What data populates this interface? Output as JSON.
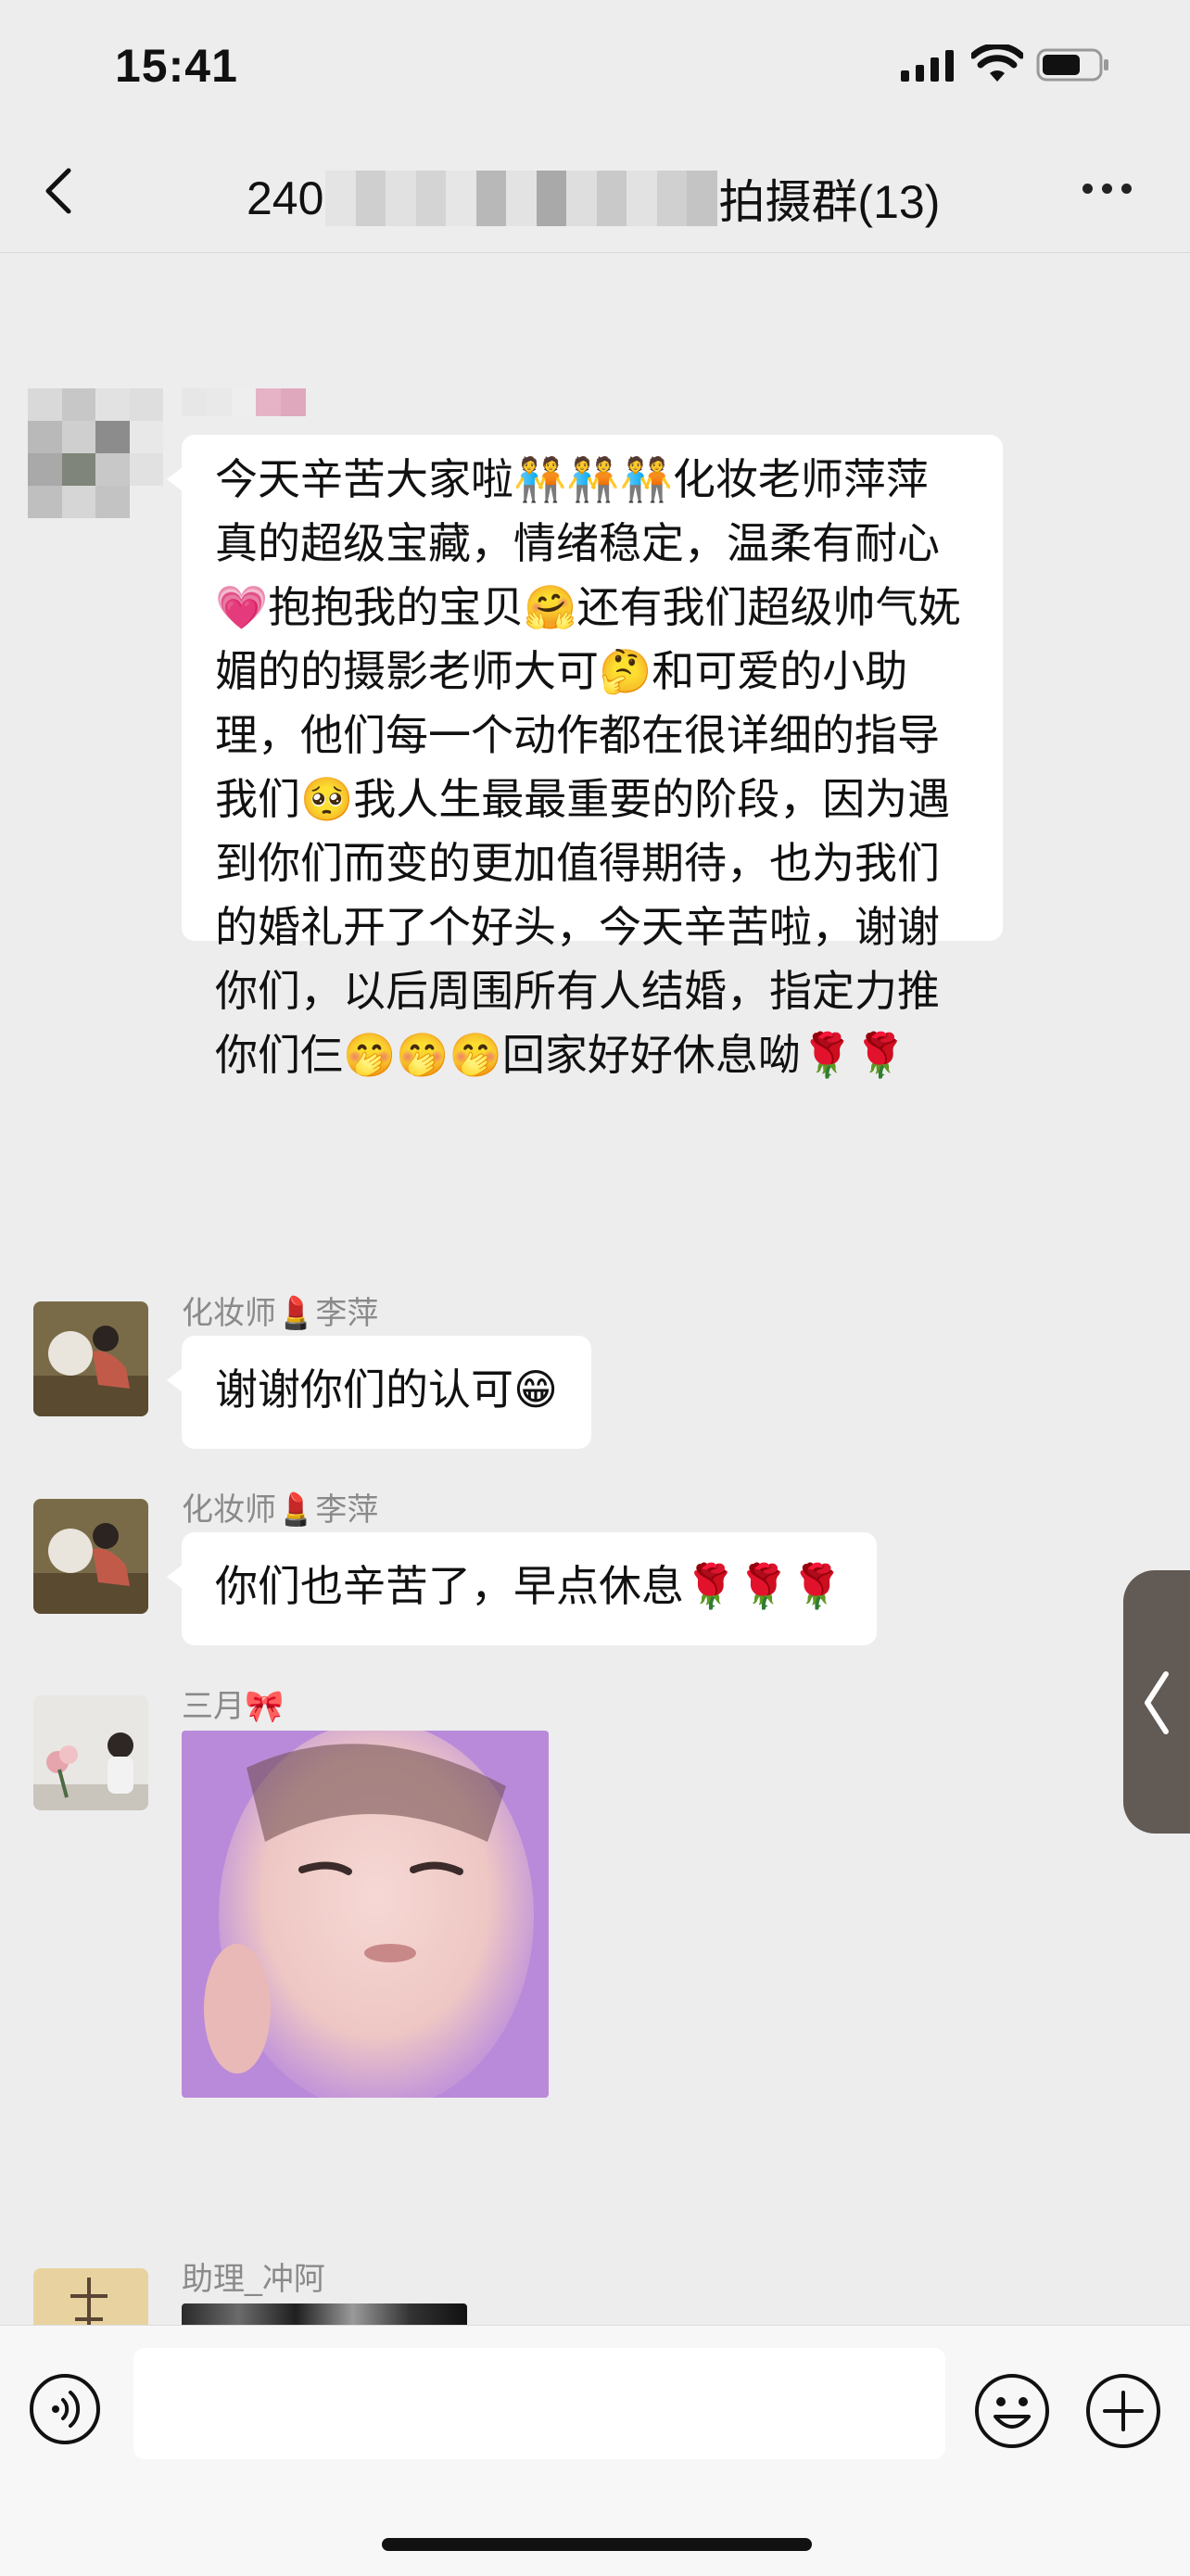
{
  "status_bar": {
    "time": "15:41"
  },
  "header": {
    "title_prefix": "240",
    "title_suffix": "拍摄群(13)"
  },
  "messages": [
    {
      "sender": "",
      "text": "今天辛苦大家啦🧑‍🤝‍🧑🧑‍🤝‍🧑🧑‍🤝‍🧑化妆老师萍萍真的超级宝藏，情绪稳定，温柔有耐心💗抱抱我的宝贝🤗还有我们超级帅气妩媚的的摄影老师大可🤔和可爱的小助理，他们每一个动作都在很详细的指导我们🥺我人生最最重要的阶段，因为遇到你们而变的更加值得期待，也为我们的婚礼开了个好头，今天辛苦啦，谢谢你们，以后周围所有人结婚，指定力推你们仨🤭🤭🤭回家好好休息呦🌹🌹"
    },
    {
      "sender": "化妆师💄李萍",
      "text": "谢谢你们的认可😁"
    },
    {
      "sender": "化妆师💄李萍",
      "text": "你们也辛苦了，早点休息🌹🌹🌹"
    },
    {
      "sender": "三月🎀",
      "text": ""
    },
    {
      "sender": "助理_冲阿",
      "text": ""
    }
  ],
  "input": {
    "placeholder": ""
  },
  "colors": {
    "background": "#ededed",
    "bubble": "#ffffff",
    "side_tab": "#615a55"
  }
}
